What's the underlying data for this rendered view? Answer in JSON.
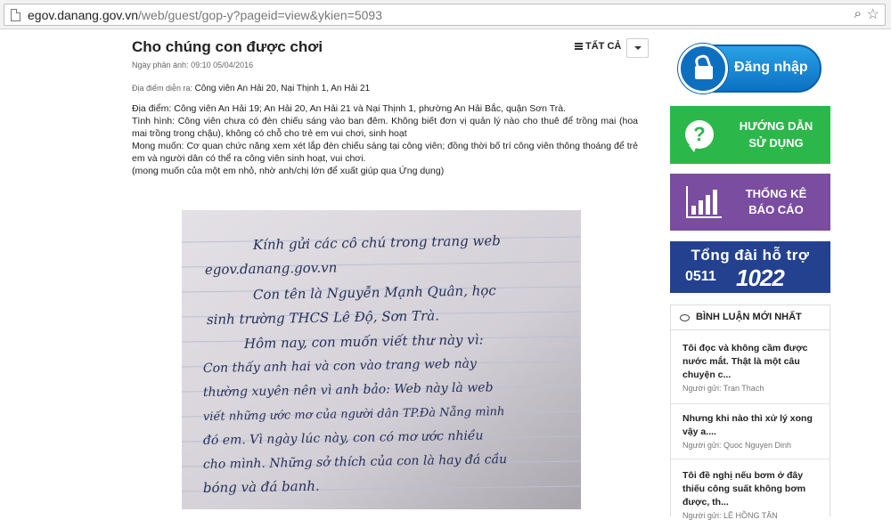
{
  "browser": {
    "url_host": "egov.danang.gov.vn",
    "url_path": "/web/guest/gop-y?pageid=view&ykien=5093"
  },
  "article": {
    "title": "Cho chúng con được chơi",
    "filter_label": "TẤT CẢ",
    "date_label": "Ngày phản ánh:",
    "date_value": "09:10 05/04/2016",
    "place_label": "Địa điểm diễn ra:",
    "place_value": "Công viên An Hải 20, Nại Thịnh 1, An Hải 21",
    "body": [
      "Địa điểm: Công viên An Hải 19; An Hải 20, An Hải 21 và Nại Thịnh 1, phường An Hải Bắc, quận Sơn Trà.",
      "Tình hình: Công viên chưa có đèn chiếu sáng vào ban đêm. Không biết đơn vị quản lý nào cho thuê để trồng mai (hoa mai trồng trong chậu), không có chỗ cho trẻ em vui chơi, sinh hoạt",
      "Mong muốn: Cơ quan chức năng xem xét lắp đèn chiếu sáng tại công viên; đồng thời bố trí công viên thông thoáng để trẻ em và người dân có thể ra công viên sinh hoạt, vui chơi.",
      "(mong muốn của một em nhỏ, nhờ anh/chị lớn để xuất giúp qua Ứng dụng)"
    ],
    "letter_lines": [
      "Kính gửi các cô chú trong trang web",
      "egov.danang.gov.vn",
      "Con tên là Nguyễn Mạnh Quân, học",
      "sinh trường THCS Lê Độ, Sơn Trà.",
      "Hôm nay, con muốn viết thư này vì:",
      "Con thấy anh hai và con vào trang web này",
      "thường xuyên nên vì anh bảo: Web này là web",
      "viết những ước mơ của người dân TP.Đà Nẵng mình",
      "đó em. Vì ngày lúc này, con có mơ ước nhiều",
      "cho mình. Những sở thích của con là hay đá cầu",
      "bóng và đá banh."
    ]
  },
  "sidebar": {
    "login_label": "Đăng nhập",
    "guide_line1": "HƯỚNG DẪN",
    "guide_line2": "SỬ DỤNG",
    "stats_line1": "THỐNG KÊ",
    "stats_line2": "BÁO CÁO",
    "hotline_title": "Tổng đài hỗ trợ",
    "hotline_prefix": "0511",
    "hotline_number": "1022"
  },
  "comments": {
    "title": "BÌNH LUẬN MỚI NHẤT",
    "items": [
      {
        "text": "Tôi đọc và không cầm được nước mắt. Thật là một câu chuyện c...",
        "author": "Người gửi: Tran Thach"
      },
      {
        "text": "Nhưng khi nào thì xử lý xong vậy a....",
        "author": "Người gửi: Quoc Nguyen Dinh"
      },
      {
        "text": "Tôi đề nghị nếu bơm ở đây thiếu công suất không bơm được, th...",
        "author": "Người gửi: LÊ HỒNG TÂN"
      }
    ]
  }
}
